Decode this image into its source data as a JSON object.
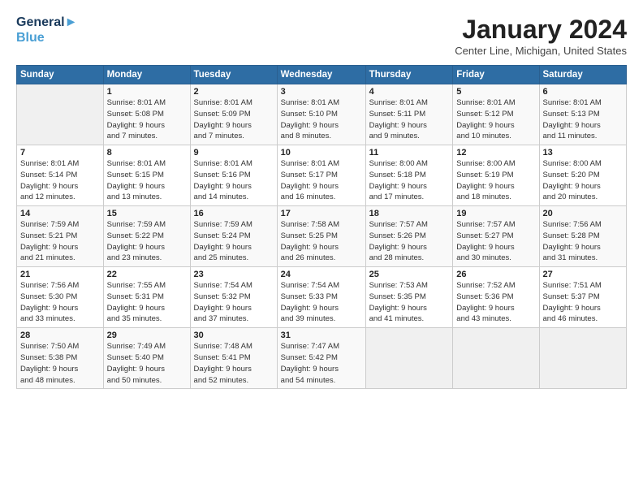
{
  "header": {
    "logo_line1": "General",
    "logo_line2": "Blue",
    "month_title": "January 2024",
    "location": "Center Line, Michigan, United States"
  },
  "weekdays": [
    "Sunday",
    "Monday",
    "Tuesday",
    "Wednesday",
    "Thursday",
    "Friday",
    "Saturday"
  ],
  "weeks": [
    [
      {
        "num": "",
        "info": ""
      },
      {
        "num": "1",
        "info": "Sunrise: 8:01 AM\nSunset: 5:08 PM\nDaylight: 9 hours\nand 7 minutes."
      },
      {
        "num": "2",
        "info": "Sunrise: 8:01 AM\nSunset: 5:09 PM\nDaylight: 9 hours\nand 7 minutes."
      },
      {
        "num": "3",
        "info": "Sunrise: 8:01 AM\nSunset: 5:10 PM\nDaylight: 9 hours\nand 8 minutes."
      },
      {
        "num": "4",
        "info": "Sunrise: 8:01 AM\nSunset: 5:11 PM\nDaylight: 9 hours\nand 9 minutes."
      },
      {
        "num": "5",
        "info": "Sunrise: 8:01 AM\nSunset: 5:12 PM\nDaylight: 9 hours\nand 10 minutes."
      },
      {
        "num": "6",
        "info": "Sunrise: 8:01 AM\nSunset: 5:13 PM\nDaylight: 9 hours\nand 11 minutes."
      }
    ],
    [
      {
        "num": "7",
        "info": "Sunrise: 8:01 AM\nSunset: 5:14 PM\nDaylight: 9 hours\nand 12 minutes."
      },
      {
        "num": "8",
        "info": "Sunrise: 8:01 AM\nSunset: 5:15 PM\nDaylight: 9 hours\nand 13 minutes."
      },
      {
        "num": "9",
        "info": "Sunrise: 8:01 AM\nSunset: 5:16 PM\nDaylight: 9 hours\nand 14 minutes."
      },
      {
        "num": "10",
        "info": "Sunrise: 8:01 AM\nSunset: 5:17 PM\nDaylight: 9 hours\nand 16 minutes."
      },
      {
        "num": "11",
        "info": "Sunrise: 8:00 AM\nSunset: 5:18 PM\nDaylight: 9 hours\nand 17 minutes."
      },
      {
        "num": "12",
        "info": "Sunrise: 8:00 AM\nSunset: 5:19 PM\nDaylight: 9 hours\nand 18 minutes."
      },
      {
        "num": "13",
        "info": "Sunrise: 8:00 AM\nSunset: 5:20 PM\nDaylight: 9 hours\nand 20 minutes."
      }
    ],
    [
      {
        "num": "14",
        "info": "Sunrise: 7:59 AM\nSunset: 5:21 PM\nDaylight: 9 hours\nand 21 minutes."
      },
      {
        "num": "15",
        "info": "Sunrise: 7:59 AM\nSunset: 5:22 PM\nDaylight: 9 hours\nand 23 minutes."
      },
      {
        "num": "16",
        "info": "Sunrise: 7:59 AM\nSunset: 5:24 PM\nDaylight: 9 hours\nand 25 minutes."
      },
      {
        "num": "17",
        "info": "Sunrise: 7:58 AM\nSunset: 5:25 PM\nDaylight: 9 hours\nand 26 minutes."
      },
      {
        "num": "18",
        "info": "Sunrise: 7:57 AM\nSunset: 5:26 PM\nDaylight: 9 hours\nand 28 minutes."
      },
      {
        "num": "19",
        "info": "Sunrise: 7:57 AM\nSunset: 5:27 PM\nDaylight: 9 hours\nand 30 minutes."
      },
      {
        "num": "20",
        "info": "Sunrise: 7:56 AM\nSunset: 5:28 PM\nDaylight: 9 hours\nand 31 minutes."
      }
    ],
    [
      {
        "num": "21",
        "info": "Sunrise: 7:56 AM\nSunset: 5:30 PM\nDaylight: 9 hours\nand 33 minutes."
      },
      {
        "num": "22",
        "info": "Sunrise: 7:55 AM\nSunset: 5:31 PM\nDaylight: 9 hours\nand 35 minutes."
      },
      {
        "num": "23",
        "info": "Sunrise: 7:54 AM\nSunset: 5:32 PM\nDaylight: 9 hours\nand 37 minutes."
      },
      {
        "num": "24",
        "info": "Sunrise: 7:54 AM\nSunset: 5:33 PM\nDaylight: 9 hours\nand 39 minutes."
      },
      {
        "num": "25",
        "info": "Sunrise: 7:53 AM\nSunset: 5:35 PM\nDaylight: 9 hours\nand 41 minutes."
      },
      {
        "num": "26",
        "info": "Sunrise: 7:52 AM\nSunset: 5:36 PM\nDaylight: 9 hours\nand 43 minutes."
      },
      {
        "num": "27",
        "info": "Sunrise: 7:51 AM\nSunset: 5:37 PM\nDaylight: 9 hours\nand 46 minutes."
      }
    ],
    [
      {
        "num": "28",
        "info": "Sunrise: 7:50 AM\nSunset: 5:38 PM\nDaylight: 9 hours\nand 48 minutes."
      },
      {
        "num": "29",
        "info": "Sunrise: 7:49 AM\nSunset: 5:40 PM\nDaylight: 9 hours\nand 50 minutes."
      },
      {
        "num": "30",
        "info": "Sunrise: 7:48 AM\nSunset: 5:41 PM\nDaylight: 9 hours\nand 52 minutes."
      },
      {
        "num": "31",
        "info": "Sunrise: 7:47 AM\nSunset: 5:42 PM\nDaylight: 9 hours\nand 54 minutes."
      },
      {
        "num": "",
        "info": ""
      },
      {
        "num": "",
        "info": ""
      },
      {
        "num": "",
        "info": ""
      }
    ]
  ]
}
